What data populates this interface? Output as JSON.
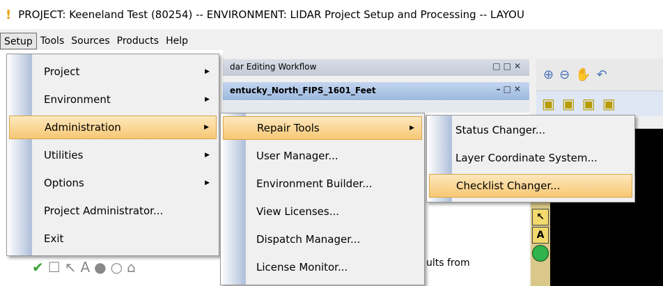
{
  "window": {
    "title": "PROJECT: Keeneland Test (80254) -- ENVIRONMENT: LIDAR Project Setup and Processing -- LAYOU"
  },
  "menubar": [
    "Setup",
    "Tools",
    "Sources",
    "Products",
    "Help"
  ],
  "panels": {
    "workflow_title": "dar Editing Workflow",
    "coord_title": "entucky_North_FIPS_1601_Feet"
  },
  "setup_menu": {
    "items": [
      {
        "label": "Project",
        "submenu": true
      },
      {
        "label": "Environment",
        "submenu": true
      },
      {
        "label": "Administration",
        "submenu": true,
        "highlighted": true
      },
      {
        "label": "Utilities",
        "submenu": true
      },
      {
        "label": "Options",
        "submenu": true
      },
      {
        "label": "Project Administrator...",
        "submenu": false
      },
      {
        "label": "Exit",
        "submenu": false
      }
    ]
  },
  "administration_menu": {
    "items": [
      {
        "label": "Repair Tools",
        "submenu": true,
        "highlighted": true
      },
      {
        "label": "User Manager...",
        "submenu": false
      },
      {
        "label": "Environment Builder...",
        "submenu": false
      },
      {
        "label": "View Licenses...",
        "submenu": false
      },
      {
        "label": "Dispatch Manager...",
        "submenu": false
      },
      {
        "label": "License Monitor...",
        "submenu": false
      }
    ]
  },
  "repair_tools_menu": {
    "items": [
      {
        "label": "Status Changer...",
        "highlighted": false
      },
      {
        "label": "Layer Coordinate System...",
        "highlighted": false
      },
      {
        "label": "Checklist Changer...",
        "highlighted": true
      }
    ]
  },
  "background": {
    "partial_text": "ults from"
  },
  "colors": {
    "menu_highlight": "#f7c874",
    "panel_title": "#9db8df"
  }
}
